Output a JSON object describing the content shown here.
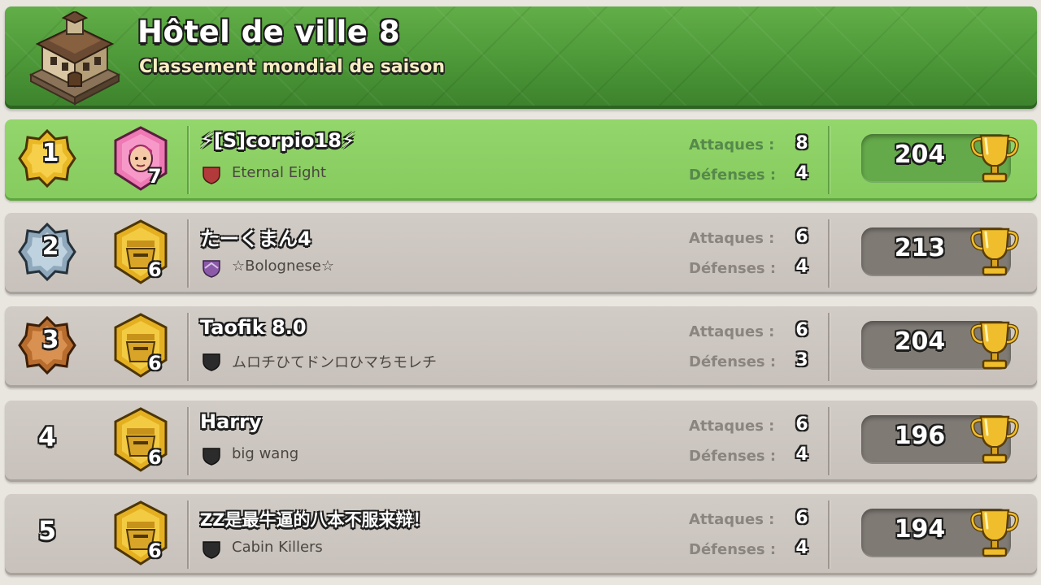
{
  "header": {
    "title": "Hôtel de ville 8",
    "subtitle": "Classement mondial de saison",
    "icon": "town-hall-8-icon"
  },
  "labels": {
    "attacks": "Attaques :",
    "defenses": "Défenses :"
  },
  "rows": [
    {
      "rank": "1",
      "rank_style": "gold-badge",
      "league": "pink-league",
      "level": "7",
      "name": "⚡[S]corpio18⚡",
      "clan": "Eternal Eight",
      "clan_shield_color": "#b33a3a",
      "attacks": "8",
      "defenses": "4",
      "trophies": "204",
      "highlight": true
    },
    {
      "rank": "2",
      "rank_style": "silver-badge",
      "league": "gold-league",
      "level": "6",
      "name": "たーくまん4",
      "clan": "☆Bolognese☆",
      "clan_shield_color": "#8a5aa8",
      "attacks": "6",
      "defenses": "4",
      "trophies": "213",
      "highlight": false
    },
    {
      "rank": "3",
      "rank_style": "bronze-badge",
      "league": "gold-league",
      "level": "6",
      "name": "Taofik 8.0",
      "clan": "ムロチひてドンロひマちモレチ",
      "clan_shield_color": "#2b2b2b",
      "attacks": "6",
      "defenses": "3",
      "trophies": "204",
      "highlight": false
    },
    {
      "rank": "4",
      "rank_style": "plain",
      "league": "gold-league",
      "level": "6",
      "name": "Harry",
      "clan": "big wang",
      "clan_shield_color": "#2b2b2b",
      "attacks": "6",
      "defenses": "4",
      "trophies": "196",
      "highlight": false
    },
    {
      "rank": "5",
      "rank_style": "plain",
      "league": "gold-league",
      "level": "6",
      "name": "ZZ是最牛逼的八本不服来辩！",
      "clan": "Cabin Killers",
      "clan_shield_color": "#2b2b2b",
      "attacks": "6",
      "defenses": "4",
      "trophies": "194",
      "highlight": false
    }
  ],
  "colors": {
    "header_green": "#4f9a3a",
    "highlight_row": "#8fd166",
    "row_bg": "#ccc5bf",
    "gold": "#e9b826",
    "silver": "#9db3c4",
    "bronze": "#c27a3a",
    "pink_league": "#ee79b4"
  }
}
